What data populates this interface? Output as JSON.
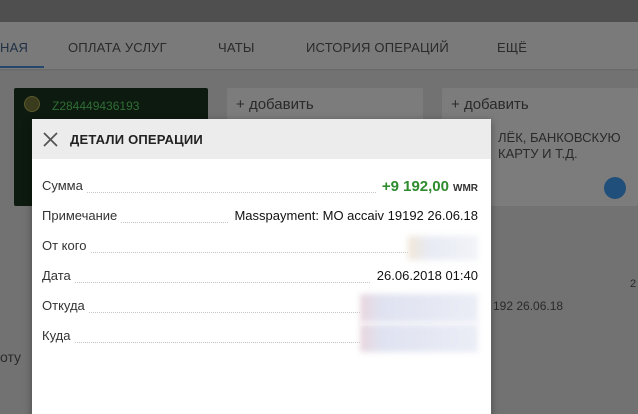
{
  "tabs": [
    {
      "label": "НАЯ",
      "active": true
    },
    {
      "label": "ОПЛАТА УСЛУГ"
    },
    {
      "label": "ЧАТЫ"
    },
    {
      "label": "ИСТОРИЯ ОПЕРАЦИЙ"
    },
    {
      "label": "ЕЩЁ"
    }
  ],
  "background": {
    "wallet_number": "Z284449436193",
    "add_label": "добавить",
    "card3_text": "ЛЁК, БАНКОВСКУЮ КАРТУ И Т.Д.",
    "right_number": "2",
    "right_text": "192 26.06.18",
    "left_text": "оту"
  },
  "modal": {
    "title": "ДЕТАЛИ ОПЕРАЦИИ",
    "rows": [
      {
        "label": "Сумма",
        "value": "+9 192,00",
        "currency": "WMR"
      },
      {
        "label": "Примечание",
        "value": "Masspayment: MO accaiv 19192 26.06.18"
      },
      {
        "label": "От кого",
        "value": ""
      },
      {
        "label": "Дата",
        "value": "26.06.2018 01:40"
      },
      {
        "label": "Откуда",
        "value": ""
      },
      {
        "label": "Куда",
        "value": ""
      }
    ]
  },
  "colors": {
    "amount": "#2e8b2e",
    "tab_underline": "#24476b",
    "wallet_card": "#0d1a0f"
  }
}
